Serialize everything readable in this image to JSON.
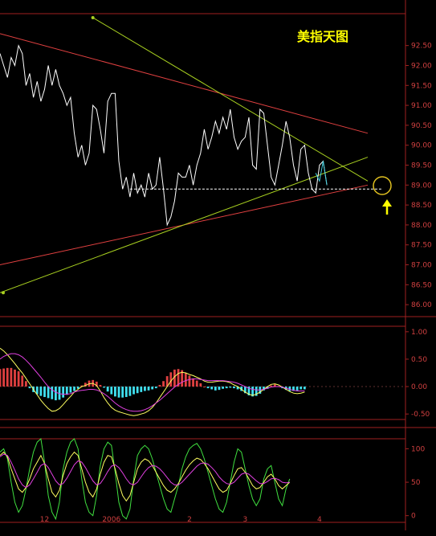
{
  "title": "美指天图",
  "chart_data": [
    {
      "type": "line",
      "title": "美指天图",
      "ylim": [
        85.7,
        93.3
      ],
      "yticks": [
        "92.50",
        "92.00",
        "91.50",
        "91.00",
        "90.50",
        "90.00",
        "89.50",
        "89.00",
        "88.50",
        "88.00",
        "87.50",
        "87.00",
        "86.50",
        "86.00"
      ],
      "ytick_values": [
        92.5,
        92.0,
        91.5,
        91.0,
        90.5,
        90.0,
        89.5,
        89.0,
        88.5,
        88.0,
        87.5,
        87.0,
        86.5,
        86.0
      ],
      "x_labels": [
        "12",
        "2006",
        "2",
        "3",
        "4"
      ],
      "x_label_index": [
        12,
        30,
        51,
        66,
        86
      ],
      "series": [
        {
          "values": [
            92.3,
            92.0,
            91.7,
            92.2,
            92.0,
            92.5,
            92.3,
            91.5,
            91.8,
            91.2,
            91.6,
            91.1,
            91.4,
            92.0,
            91.5,
            91.9,
            91.5,
            91.3,
            91.0,
            91.2,
            90.3,
            89.7,
            90.0,
            89.5,
            89.8,
            91.0,
            90.9,
            90.4,
            89.8,
            91.1,
            91.3,
            91.3,
            89.6,
            88.9,
            89.2,
            88.7,
            89.3,
            88.8,
            89.0,
            88.7,
            89.3,
            88.9,
            89.0,
            89.7,
            88.9,
            88.0,
            88.2,
            88.6,
            89.3,
            89.2,
            89.2,
            89.5,
            89.0,
            89.5,
            89.8,
            90.4,
            89.9,
            90.2,
            90.6,
            90.3,
            90.7,
            90.4,
            90.9,
            90.2,
            89.9,
            90.1,
            90.2,
            90.7,
            89.5,
            89.4,
            90.9,
            90.8,
            90.0,
            89.2,
            89.0,
            89.5,
            90.0,
            90.6,
            90.2,
            89.5,
            89.1,
            89.9,
            90.0,
            89.3,
            88.9,
            88.8,
            89.5,
            89.6,
            89.0
          ]
        },
        {
          "values": [
            89.3,
            89.1,
            89.6,
            89.0
          ]
        }
      ],
      "lines": [
        {
          "x": [
            0,
            99
          ],
          "y": [
            92.8,
            90.3
          ]
        },
        {
          "x": [
            0,
            99
          ],
          "y": [
            87.0,
            89.0
          ]
        },
        {
          "x": [
            0,
            99
          ],
          "y": [
            86.3,
            89.7
          ]
        },
        {
          "x": [
            25,
            99
          ],
          "y": [
            93.2,
            89.1
          ]
        },
        {
          "x": [
            35,
            99
          ],
          "y": [
            88.9,
            88.9
          ]
        }
      ]
    },
    {
      "type": "bar",
      "title": "MACD",
      "ylim": [
        -0.6,
        1.1
      ],
      "yticks": [
        "1.00",
        "0.50",
        "0.00",
        "-0.50"
      ],
      "ytick_values": [
        1.0,
        0.5,
        0.0,
        -0.5
      ],
      "series": [
        {
          "values": [
            0.32,
            0.33,
            0.34,
            0.34,
            0.31,
            0.28,
            0.2,
            0.1,
            -0.03,
            -0.1,
            -0.14,
            -0.17,
            -0.19,
            -0.21,
            -0.23,
            -0.25,
            -0.24,
            -0.2,
            -0.15,
            -0.11,
            -0.08,
            -0.04,
            0.02,
            0.07,
            0.11,
            0.12,
            0.09,
            0.03,
            -0.02,
            -0.09,
            -0.14,
            -0.18,
            -0.2,
            -0.2,
            -0.19,
            -0.17,
            -0.14,
            -0.12,
            -0.1,
            -0.08,
            -0.07,
            -0.05,
            -0.03,
            0.03,
            0.1,
            0.19,
            0.26,
            0.31,
            0.32,
            0.3,
            0.25,
            0.2,
            0.15,
            0.11,
            0.06,
            0.0,
            -0.03,
            -0.05,
            -0.07,
            -0.06,
            -0.04,
            -0.03,
            -0.02,
            -0.03,
            -0.05,
            -0.08,
            -0.12,
            -0.16,
            -0.18,
            -0.17,
            -0.13,
            -0.07,
            -0.04,
            0.02,
            0.04,
            0.01,
            -0.03,
            -0.06,
            -0.08,
            -0.08,
            -0.07,
            -0.05,
            -0.05
          ]
        },
        {
          "values": [
            0.7,
            0.65,
            0.58,
            0.5,
            0.42,
            0.33,
            0.25,
            0.15,
            0.05,
            -0.05,
            -0.15,
            -0.25,
            -0.33,
            -0.4,
            -0.45,
            -0.44,
            -0.4,
            -0.33,
            -0.25,
            -0.18,
            -0.1,
            -0.05,
            0.0,
            0.02,
            0.05,
            0.06,
            0.02,
            -0.08,
            -0.2,
            -0.3,
            -0.38,
            -0.43,
            -0.46,
            -0.48,
            -0.5,
            -0.52,
            -0.53,
            -0.52,
            -0.5,
            -0.48,
            -0.44,
            -0.38,
            -0.3,
            -0.2,
            -0.1,
            0.0,
            0.1,
            0.18,
            0.24,
            0.26,
            0.25,
            0.22,
            0.2,
            0.17,
            0.14,
            0.1,
            0.08,
            0.08,
            0.09,
            0.1,
            0.1,
            0.09,
            0.07,
            0.03,
            0.0,
            -0.05,
            -0.1,
            -0.14,
            -0.16,
            -0.14,
            -0.1,
            -0.05,
            0.0,
            0.04,
            0.05,
            0.03,
            -0.01,
            -0.05,
            -0.09,
            -0.12,
            -0.13,
            -0.12,
            -0.1
          ]
        },
        {
          "values": [
            0.5,
            0.55,
            0.58,
            0.6,
            0.6,
            0.58,
            0.54,
            0.48,
            0.41,
            0.33,
            0.25,
            0.17,
            0.08,
            0.0,
            -0.06,
            -0.1,
            -0.13,
            -0.14,
            -0.14,
            -0.13,
            -0.1,
            -0.08,
            -0.07,
            -0.06,
            -0.05,
            -0.05,
            -0.06,
            -0.09,
            -0.13,
            -0.18,
            -0.24,
            -0.3,
            -0.35,
            -0.39,
            -0.42,
            -0.44,
            -0.45,
            -0.45,
            -0.44,
            -0.42,
            -0.39,
            -0.35,
            -0.3,
            -0.25,
            -0.19,
            -0.13,
            -0.07,
            -0.01,
            0.04,
            0.08,
            0.11,
            0.13,
            0.14,
            0.14,
            0.13,
            0.12,
            0.11,
            0.11,
            0.11,
            0.11,
            0.11,
            0.1,
            0.09,
            0.08,
            0.06,
            0.03,
            0.0,
            -0.03,
            -0.05,
            -0.06,
            -0.06,
            -0.05,
            -0.03,
            -0.01,
            0.0,
            0.0,
            -0.01,
            -0.03,
            -0.05,
            -0.07,
            -0.08,
            -0.08,
            -0.08
          ]
        }
      ]
    },
    {
      "type": "line",
      "title": "KDJ",
      "ylim": [
        -10,
        115
      ],
      "yticks": [
        "100",
        "50",
        "0"
      ],
      "ytick_values": [
        100,
        50,
        0
      ],
      "series": [
        {
          "values": [
            90,
            95,
            88,
            70,
            55,
            40,
            35,
            42,
            55,
            70,
            80,
            90,
            78,
            55,
            35,
            28,
            38,
            60,
            78,
            88,
            95,
            90,
            70,
            50,
            35,
            28,
            40,
            62,
            80,
            90,
            88,
            70,
            48,
            30,
            22,
            30,
            50,
            70,
            80,
            85,
            82,
            75,
            65,
            55,
            45,
            38,
            35,
            40,
            48,
            58,
            68,
            76,
            82,
            86,
            84,
            78,
            70,
            60,
            50,
            40,
            35,
            38,
            48,
            60,
            70,
            72,
            65,
            55,
            45,
            40,
            42,
            50,
            58,
            62,
            55,
            45,
            40,
            45,
            50
          ]
        },
        {
          "values": [
            95,
            100,
            85,
            50,
            20,
            5,
            15,
            40,
            70,
            95,
            110,
            115,
            80,
            30,
            5,
            -5,
            20,
            70,
            95,
            110,
            115,
            100,
            55,
            20,
            5,
            0,
            30,
            75,
            100,
            110,
            105,
            65,
            20,
            0,
            -5,
            10,
            55,
            90,
            100,
            105,
            100,
            85,
            65,
            45,
            25,
            10,
            5,
            25,
            45,
            70,
            88,
            100,
            105,
            108,
            100,
            85,
            65,
            45,
            25,
            10,
            5,
            20,
            50,
            80,
            100,
            95,
            70,
            45,
            25,
            15,
            25,
            55,
            70,
            75,
            50,
            25,
            15,
            40,
            55
          ]
        },
        {
          "values": [
            88,
            92,
            90,
            80,
            68,
            55,
            46,
            42,
            46,
            55,
            65,
            75,
            78,
            72,
            62,
            52,
            46,
            48,
            56,
            66,
            76,
            82,
            80,
            72,
            62,
            52,
            46,
            48,
            56,
            66,
            74,
            76,
            72,
            64,
            55,
            48,
            46,
            50,
            58,
            66,
            72,
            75,
            74,
            70,
            64,
            57,
            50,
            46,
            46,
            50,
            56,
            62,
            68,
            74,
            78,
            79,
            77,
            72,
            66,
            58,
            52,
            48,
            47,
            50,
            56,
            62,
            64,
            62,
            57,
            52,
            48,
            48,
            51,
            55,
            56,
            54,
            50,
            49,
            50
          ]
        }
      ]
    }
  ]
}
